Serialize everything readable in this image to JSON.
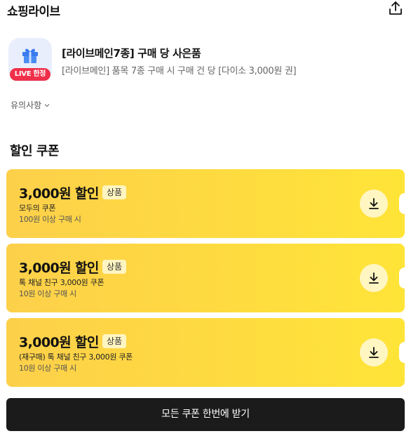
{
  "header": {
    "title": "쇼핑라이브",
    "share_icon": "share-icon"
  },
  "gift": {
    "icon": "gift-icon",
    "badge": "LIVE 한정",
    "title": "[라이브메인7종] 구매 당 사은품",
    "description": "[라이브메인] 품목 7종 구매 시 구매 건 당 [다이소 3,000원 권]"
  },
  "notice": {
    "label": "유의사항",
    "icon": "chevron-down-icon"
  },
  "coupons_section": {
    "title": "할인 쿠폰",
    "items": [
      {
        "amount": "3,000원 할인",
        "tag": "상품",
        "name": "모두의 쿠폰",
        "condition": "100원 이상 구매 시"
      },
      {
        "amount": "3,000원 할인",
        "tag": "상품",
        "name": "톡 채널 친구 3,000원 쿠폰",
        "condition": "10원 이상 구매 시"
      },
      {
        "amount": "3,000원 할인",
        "tag": "상품",
        "name": "(재구매) 톡 채널 친구 3,000원 쿠폰",
        "condition": "10원 이상 구매 시"
      }
    ],
    "download_icon": "download-icon"
  },
  "download_all": {
    "label": "모든 쿠폰 한번에 받기"
  },
  "colors": {
    "coupon_start": "#fdd04a",
    "coupon_end": "#ffe438",
    "badge": "#f0304a",
    "button": "#1b1b1b"
  }
}
